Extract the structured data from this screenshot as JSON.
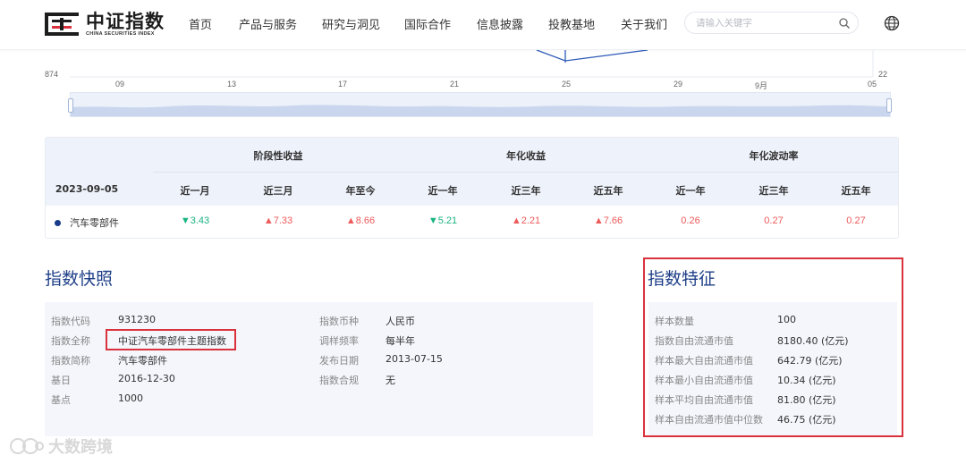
{
  "header": {
    "logo_cn": "中证指数",
    "logo_en": "CHINA SECURITIES INDEX",
    "nav": [
      "首页",
      "产品与服务",
      "研究与洞见",
      "国际合作",
      "信息披露",
      "投教基地",
      "关于我们"
    ],
    "search_placeholder": "请输入关键字"
  },
  "chart": {
    "y_left_label": "874",
    "y_right_label": "22",
    "x_ticks": [
      "09",
      "13",
      "17",
      "21",
      "25",
      "29",
      "9月",
      "05"
    ]
  },
  "performance": {
    "date": "2023-09-05",
    "groups": [
      "阶段性收益",
      "年化收益",
      "年化波动率"
    ],
    "columns": [
      "近一月",
      "近三月",
      "年至今",
      "近一年",
      "近三年",
      "近五年",
      "近一年",
      "近三年",
      "近五年"
    ],
    "row": {
      "name": "汽车零部件",
      "values": [
        {
          "text": "3.43",
          "dir": "down"
        },
        {
          "text": "7.33",
          "dir": "up"
        },
        {
          "text": "8.66",
          "dir": "up"
        },
        {
          "text": "5.21",
          "dir": "down"
        },
        {
          "text": "2.21",
          "dir": "up"
        },
        {
          "text": "7.66",
          "dir": "up"
        },
        {
          "text": "0.26",
          "dir": "none"
        },
        {
          "text": "0.27",
          "dir": "none"
        },
        {
          "text": "0.27",
          "dir": "none"
        }
      ]
    },
    "colors": {
      "up": "#ee5a5a",
      "down": "#1bb382"
    }
  },
  "snapshot": {
    "title": "指数快照",
    "left": [
      {
        "label": "指数代码",
        "value": "931230"
      },
      {
        "label": "指数全称",
        "value": "中证汽车零部件主题指数"
      },
      {
        "label": "指数简称",
        "value": "汽车零部件"
      },
      {
        "label": "基日",
        "value": "2016-12-30"
      },
      {
        "label": "基点",
        "value": "1000"
      }
    ],
    "right": [
      {
        "label": "指数币种",
        "value": "人民币"
      },
      {
        "label": "调样频率",
        "value": "每半年"
      },
      {
        "label": "发布日期",
        "value": "2013-07-15"
      },
      {
        "label": "指数合规",
        "value": "无"
      }
    ]
  },
  "features": {
    "title": "指数特征",
    "items": [
      {
        "label": "样本数量",
        "value": "100"
      },
      {
        "label": "指数自由流通市值",
        "value": "8180.40 (亿元)"
      },
      {
        "label": "样本最大自由流通市值",
        "value": "642.79 (亿元)"
      },
      {
        "label": "样本最小自由流通市值",
        "value": "10.34 (亿元)"
      },
      {
        "label": "样本平均自由流通市值",
        "value": "81.80 (亿元)"
      },
      {
        "label": "样本自由流通市值中位数",
        "value": "46.75 (亿元)"
      }
    ]
  },
  "watermark": "大数跨境"
}
